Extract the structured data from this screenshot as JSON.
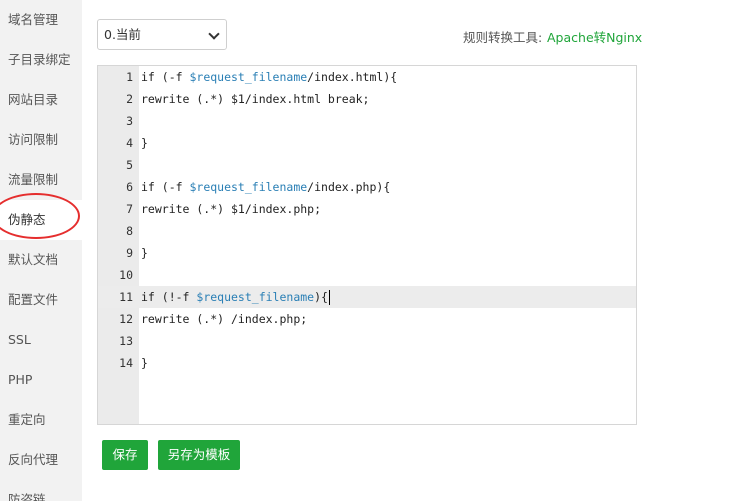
{
  "sidebar": {
    "items": [
      {
        "label": "域名管理"
      },
      {
        "label": "子目录绑定"
      },
      {
        "label": "网站目录"
      },
      {
        "label": "访问限制"
      },
      {
        "label": "流量限制"
      },
      {
        "label": "伪静态",
        "active": true
      },
      {
        "label": "默认文档"
      },
      {
        "label": "配置文件"
      },
      {
        "label": "SSL"
      },
      {
        "label": "PHP"
      },
      {
        "label": "重定向"
      },
      {
        "label": "反向代理"
      },
      {
        "label": "防盗链"
      }
    ]
  },
  "toolbar": {
    "version_selected": "0.当前",
    "tool_label": "规则转换工具:",
    "tool_link": "Apache转Nginx"
  },
  "editor": {
    "current_line": 11,
    "lines": [
      {
        "n": "1",
        "text": "if (-f $request_filename/index.html){"
      },
      {
        "n": "2",
        "text": "rewrite (.*) $1/index.html break;"
      },
      {
        "n": "3",
        "text": ""
      },
      {
        "n": "4",
        "text": "}"
      },
      {
        "n": "5",
        "text": ""
      },
      {
        "n": "6",
        "text": "if (-f $request_filename/index.php){"
      },
      {
        "n": "7",
        "text": "rewrite (.*) $1/index.php;"
      },
      {
        "n": "8",
        "text": ""
      },
      {
        "n": "9",
        "text": "}"
      },
      {
        "n": "10",
        "text": ""
      },
      {
        "n": "11",
        "text": "if (!-f $request_filename){"
      },
      {
        "n": "12",
        "text": "rewrite (.*) /index.php;"
      },
      {
        "n": "13",
        "text": ""
      },
      {
        "n": "14",
        "text": "}"
      }
    ]
  },
  "buttons": {
    "save": "保存",
    "save_template": "另存为模板"
  },
  "colors": {
    "accent": "#20a53a",
    "annotation": "#e52e2e"
  }
}
